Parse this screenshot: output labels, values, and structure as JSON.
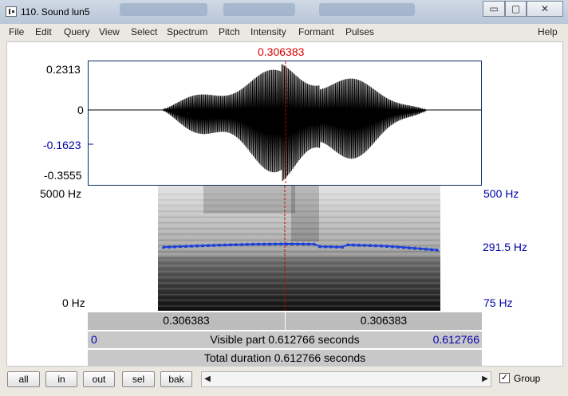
{
  "window": {
    "title": "110. Sound lun5",
    "minimize": "▭",
    "maximize": "▢",
    "close": "✕"
  },
  "menu": [
    "File",
    "Edit",
    "Query",
    "View",
    "Select",
    "Spectrum",
    "Pitch",
    "Intensity",
    "Formant",
    "Pulses"
  ],
  "menu_help": "Help",
  "cursor_time": "0.306383",
  "waveform": {
    "y_max": "0.2313",
    "y_zero": "0",
    "y_cursor": "-0.1623",
    "y_min": "-0.3555"
  },
  "spectrogram": {
    "freq_top": "5000 Hz",
    "freq_bottom": "0 Hz"
  },
  "pitch": {
    "top": "500 Hz",
    "mid": "291.5 Hz",
    "bottom": "75 Hz"
  },
  "selection": {
    "left_time": "0.306383",
    "right_time": "0.306383"
  },
  "visible": {
    "start": "0",
    "text": "Visible part 0.612766 seconds",
    "end": "0.612766"
  },
  "total": {
    "text": "Total duration 0.612766 seconds"
  },
  "buttons": {
    "all": "all",
    "in": "in",
    "out": "out",
    "sel": "sel",
    "bak": "bak"
  },
  "scroll": {
    "left": "◀",
    "right": "▶"
  },
  "group": {
    "label": "Group",
    "checked": "✓"
  },
  "colors": {
    "accent_blue": "#0000aa",
    "cursor_red": "#d40000",
    "pitch_blue": "#1a3fd8"
  }
}
